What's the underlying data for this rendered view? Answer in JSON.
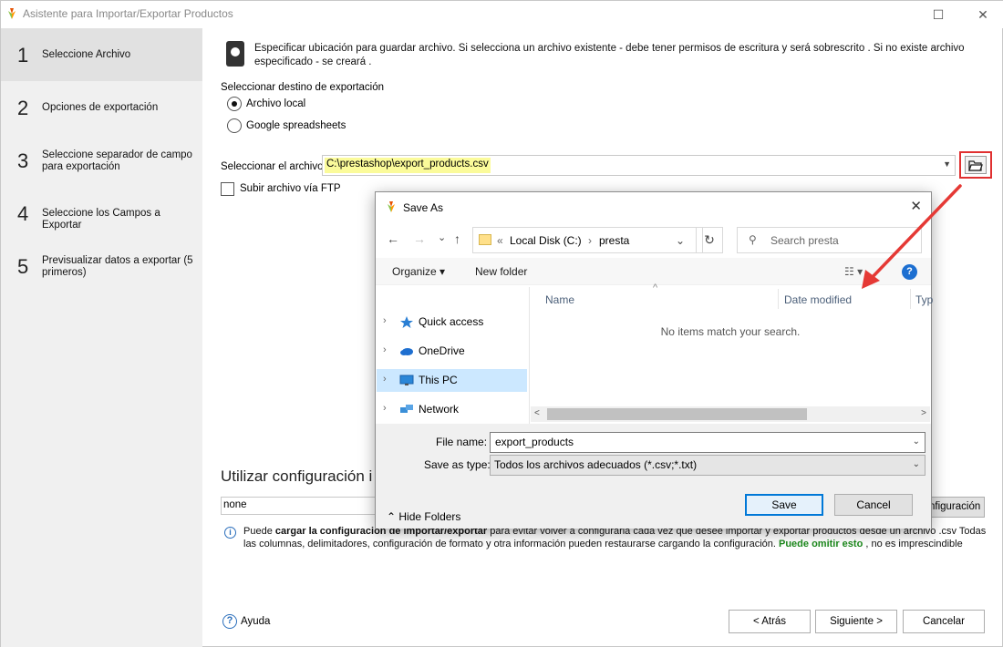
{
  "window": {
    "title": "Asistente para Importar/Exportar Productos",
    "maximize_glyph": "☐",
    "close_glyph": "✕"
  },
  "steps": [
    {
      "num": "1",
      "label": "Seleccione Archivo"
    },
    {
      "num": "2",
      "label": "Opciones de exportación"
    },
    {
      "num": "3",
      "label": "Seleccione separador de campo para exportación"
    },
    {
      "num": "4",
      "label": "Seleccione los Campos a Exportar"
    },
    {
      "num": "5",
      "label": "Previsualizar datos a exportar (5 primeros)"
    }
  ],
  "main": {
    "intro": "Especificar ubicación para guardar archivo. Si selecciona un archivo existente - debe tener permisos de escritura y será sobrescrito . Si no existe archivo especificado - se creará .",
    "destination_label": "Seleccionar destino de exportación",
    "radio_local": "Archivo local",
    "radio_google": "Google spreadsheets",
    "file_label": "Seleccionar el archivo",
    "file_value": "C:\\prestashop\\export_products.csv",
    "ftp_label": "Subir archivo vía FTP",
    "config_title": "Utilizar configuración i",
    "config_value": "none",
    "config_button": "nfiguración",
    "info_part1": "Puede ",
    "info_bold": "cargar la configuración de importar/exportar",
    "info_part2": " para evitar volver a configurarla cada vez que desee importar y exportar productos desde un archivo .csv Todas las columnas, delimitadores, configuración de formato y otra información pueden restaurarse cargando la configuración. ",
    "info_green": "Puede omitir esto",
    "info_part3": " , no es imprescindible",
    "help_label": "Ayuda",
    "back_button": "< Atrás",
    "next_button": "Siguiente >",
    "cancel_button": "Cancelar"
  },
  "dialog": {
    "title": "Save As",
    "close_glyph": "✕",
    "back_glyph": "←",
    "forward_glyph": "→",
    "recent_glyph": "⌄",
    "up_glyph": "↑",
    "breadcrumb_prefix": "«",
    "breadcrumb_drive": "Local Disk (C:)",
    "breadcrumb_sep": "›",
    "breadcrumb_folder": "presta",
    "addr_dropdown_glyph": "⌄",
    "refresh_glyph": "↻",
    "search_icon_glyph": "⚲",
    "search_placeholder": "Search presta",
    "organize_label": "Organize ▾",
    "new_folder_label": "New folder",
    "view_glyph": "☷ ▾",
    "help_glyph": "?",
    "nav_items": [
      {
        "label": "Quick access"
      },
      {
        "label": "OneDrive"
      },
      {
        "label": "This PC"
      },
      {
        "label": "Network"
      }
    ],
    "nav_chevron": "›",
    "sort_glyph": "^",
    "columns": [
      "Name",
      "Date modified",
      "Typ"
    ],
    "empty_message": "No items match your search.",
    "scroll_left": "<",
    "scroll_right": ">",
    "file_name_label": "File name:",
    "file_name_value": "export_products",
    "save_type_label": "Save as type:",
    "save_type_value": "Todos los archivos adecuados (*.csv;*.txt)",
    "dropdown_glyph": "⌄",
    "hide_folders": "Hide Folders",
    "save_button": "Save",
    "cancel_button": "Cancel"
  },
  "colors": {
    "highlight": "#fbfb9a",
    "annotation": "#e03030",
    "accent": "#0078d7",
    "nav_selected": "#cce8ff",
    "green_text": "#1d8a1d"
  }
}
